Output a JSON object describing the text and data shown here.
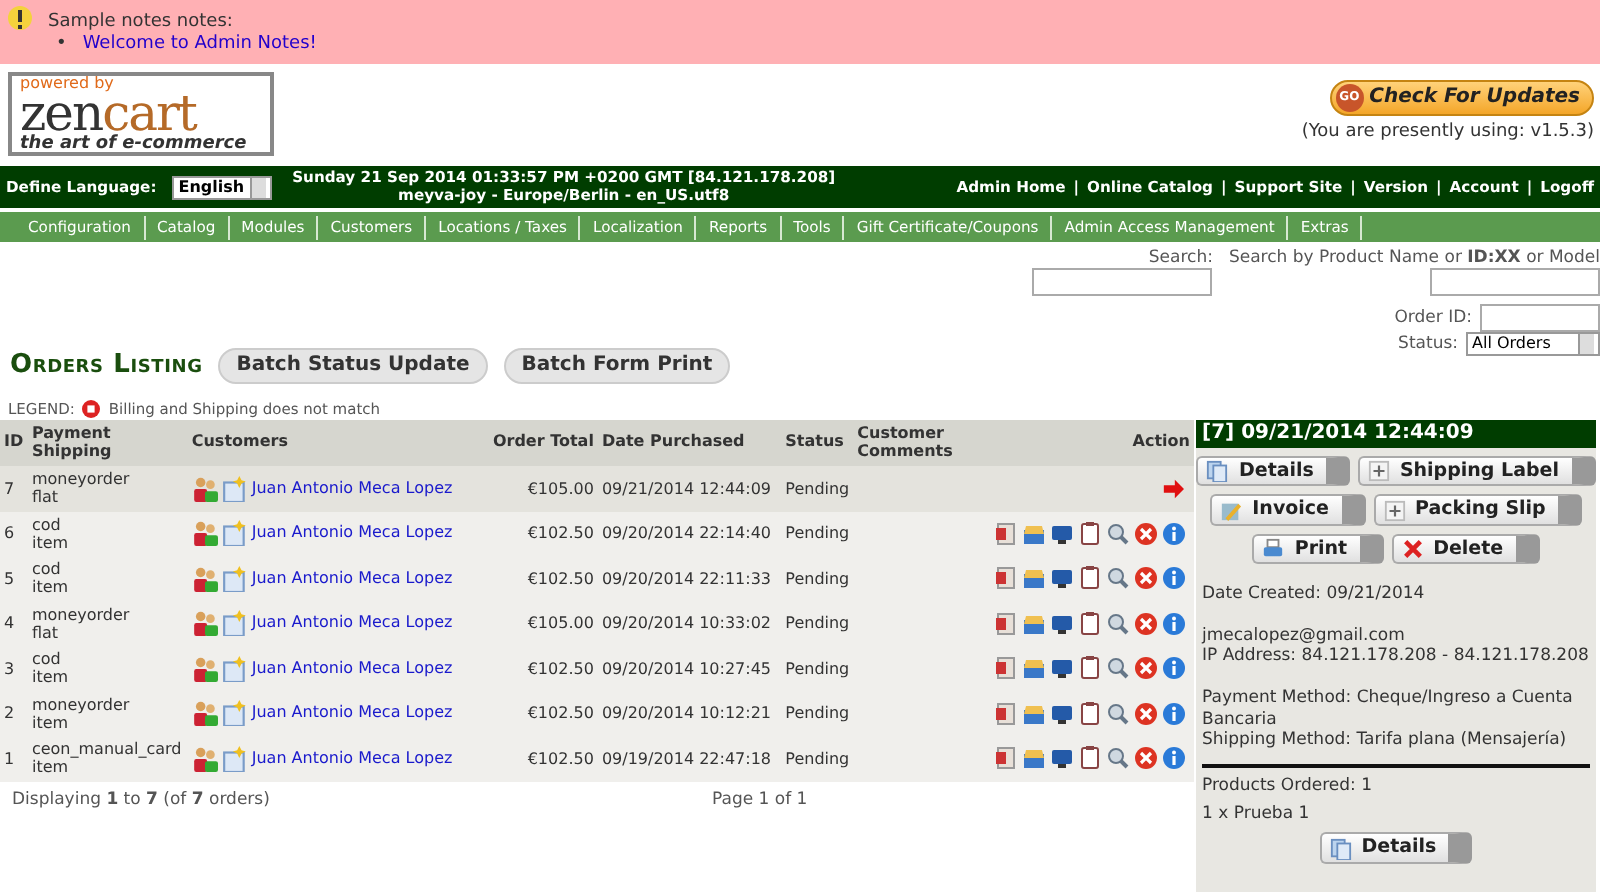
{
  "notes": {
    "title": "Sample notes notes:",
    "bullet": "•",
    "items": [
      "Welcome to Admin Notes!"
    ]
  },
  "header": {
    "logo_top": "powered by",
    "logo_zen": "zen",
    "logo_cart": "cart",
    "logo_tagline": "the art of e-commerce",
    "update_badge": "GO",
    "update_button": "Check For Updates",
    "version_text": "(You are presently using: v1.5.3)"
  },
  "top_bar": {
    "language_label": "Define Language:",
    "language_value": "English",
    "datetime": "Sunday 21 Sep 2014 01:33:57 PM +0200 GMT [84.121.178.208]",
    "host": "meyva-joy - Europe/Berlin - en_US.utf8",
    "links": [
      "Admin Home",
      "Online Catalog",
      "Support Site",
      "Version",
      "Account",
      "Logoff"
    ],
    "separator": "|"
  },
  "menu": [
    "Configuration",
    "Catalog",
    "Modules",
    "Customers",
    "Locations / Taxes",
    "Localization",
    "Reports",
    "Tools",
    "Gift Certificate/Coupons",
    "Admin Access Management",
    "Extras"
  ],
  "search": {
    "search_label": "Search:",
    "product_label": "Search by Product Name or **ID:XX** or Model",
    "order_id_label": "Order ID:",
    "status_label": "Status:",
    "status_value": "All Orders"
  },
  "orders": {
    "title": "Orders Listing",
    "buttons": [
      "Batch Status Update",
      "Batch Form Print"
    ],
    "legend_label": "LEGEND:",
    "legend_text": "Billing and Shipping does not match",
    "columns": [
      "ID",
      "Payment\nShipping",
      "Customers",
      "Order Total",
      "Date Purchased",
      "Status",
      "Customer\nComments",
      "Action"
    ],
    "rows": [
      {
        "id": "7",
        "payment": "moneyorder",
        "shipping": "flat",
        "customer": "Juan Antonio Meca Lopez",
        "total": "€105.00",
        "date": "09/21/2014 12:44:09",
        "status": "Pending",
        "selected": true
      },
      {
        "id": "6",
        "payment": "cod",
        "shipping": "item",
        "customer": "Juan Antonio Meca Lopez",
        "total": "€102.50",
        "date": "09/20/2014 22:14:40",
        "status": "Pending",
        "selected": false
      },
      {
        "id": "5",
        "payment": "cod",
        "shipping": "item",
        "customer": "Juan Antonio Meca Lopez",
        "total": "€102.50",
        "date": "09/20/2014 22:11:33",
        "status": "Pending",
        "selected": false
      },
      {
        "id": "4",
        "payment": "moneyorder",
        "shipping": "flat",
        "customer": "Juan Antonio Meca Lopez",
        "total": "€105.00",
        "date": "09/20/2014 10:33:02",
        "status": "Pending",
        "selected": false
      },
      {
        "id": "3",
        "payment": "cod",
        "shipping": "item",
        "customer": "Juan Antonio Meca Lopez",
        "total": "€102.50",
        "date": "09/20/2014 10:27:45",
        "status": "Pending",
        "selected": false
      },
      {
        "id": "2",
        "payment": "moneyorder",
        "shipping": "item",
        "customer": "Juan Antonio Meca Lopez",
        "total": "€102.50",
        "date": "09/20/2014 10:12:21",
        "status": "Pending",
        "selected": false
      },
      {
        "id": "1",
        "payment": "ceon_manual_card",
        "shipping": "item",
        "customer": "Juan Antonio Meca Lopez",
        "total": "€102.50",
        "date": "09/19/2014 22:47:18",
        "status": "Pending",
        "selected": false
      }
    ],
    "footer_count": "Displaying **1** to **7** (of **7** orders)",
    "footer_page": "Page 1 of 1"
  },
  "detail": {
    "title": "[7]  09/21/2014 12:44:09",
    "buttons": [
      [
        {
          "label": "Details",
          "kind": "pages"
        },
        {
          "label": "Shipping Label",
          "kind": "plus"
        }
      ],
      [
        {
          "label": "Invoice",
          "kind": "pencil"
        },
        {
          "label": "Packing Slip",
          "kind": "plus"
        }
      ],
      [
        {
          "label": "Print",
          "kind": "printer"
        },
        {
          "label": "Delete",
          "kind": "cross"
        }
      ]
    ],
    "date_created": "Date Created: 09/21/2014",
    "email": "jmecalopez@gmail.com",
    "ip": "IP Address: 84.121.178.208 - 84.121.178.208",
    "payment_method": "Payment Method: Cheque/Ingreso a Cuenta Bancaria",
    "shipping_method": "Shipping Method: Tarifa plana (Mensajería)",
    "products_ordered": "Products Ordered: 1",
    "product_line": "1 x Prueba 1",
    "details_button": {
      "label": "Details",
      "kind": "pages"
    }
  }
}
